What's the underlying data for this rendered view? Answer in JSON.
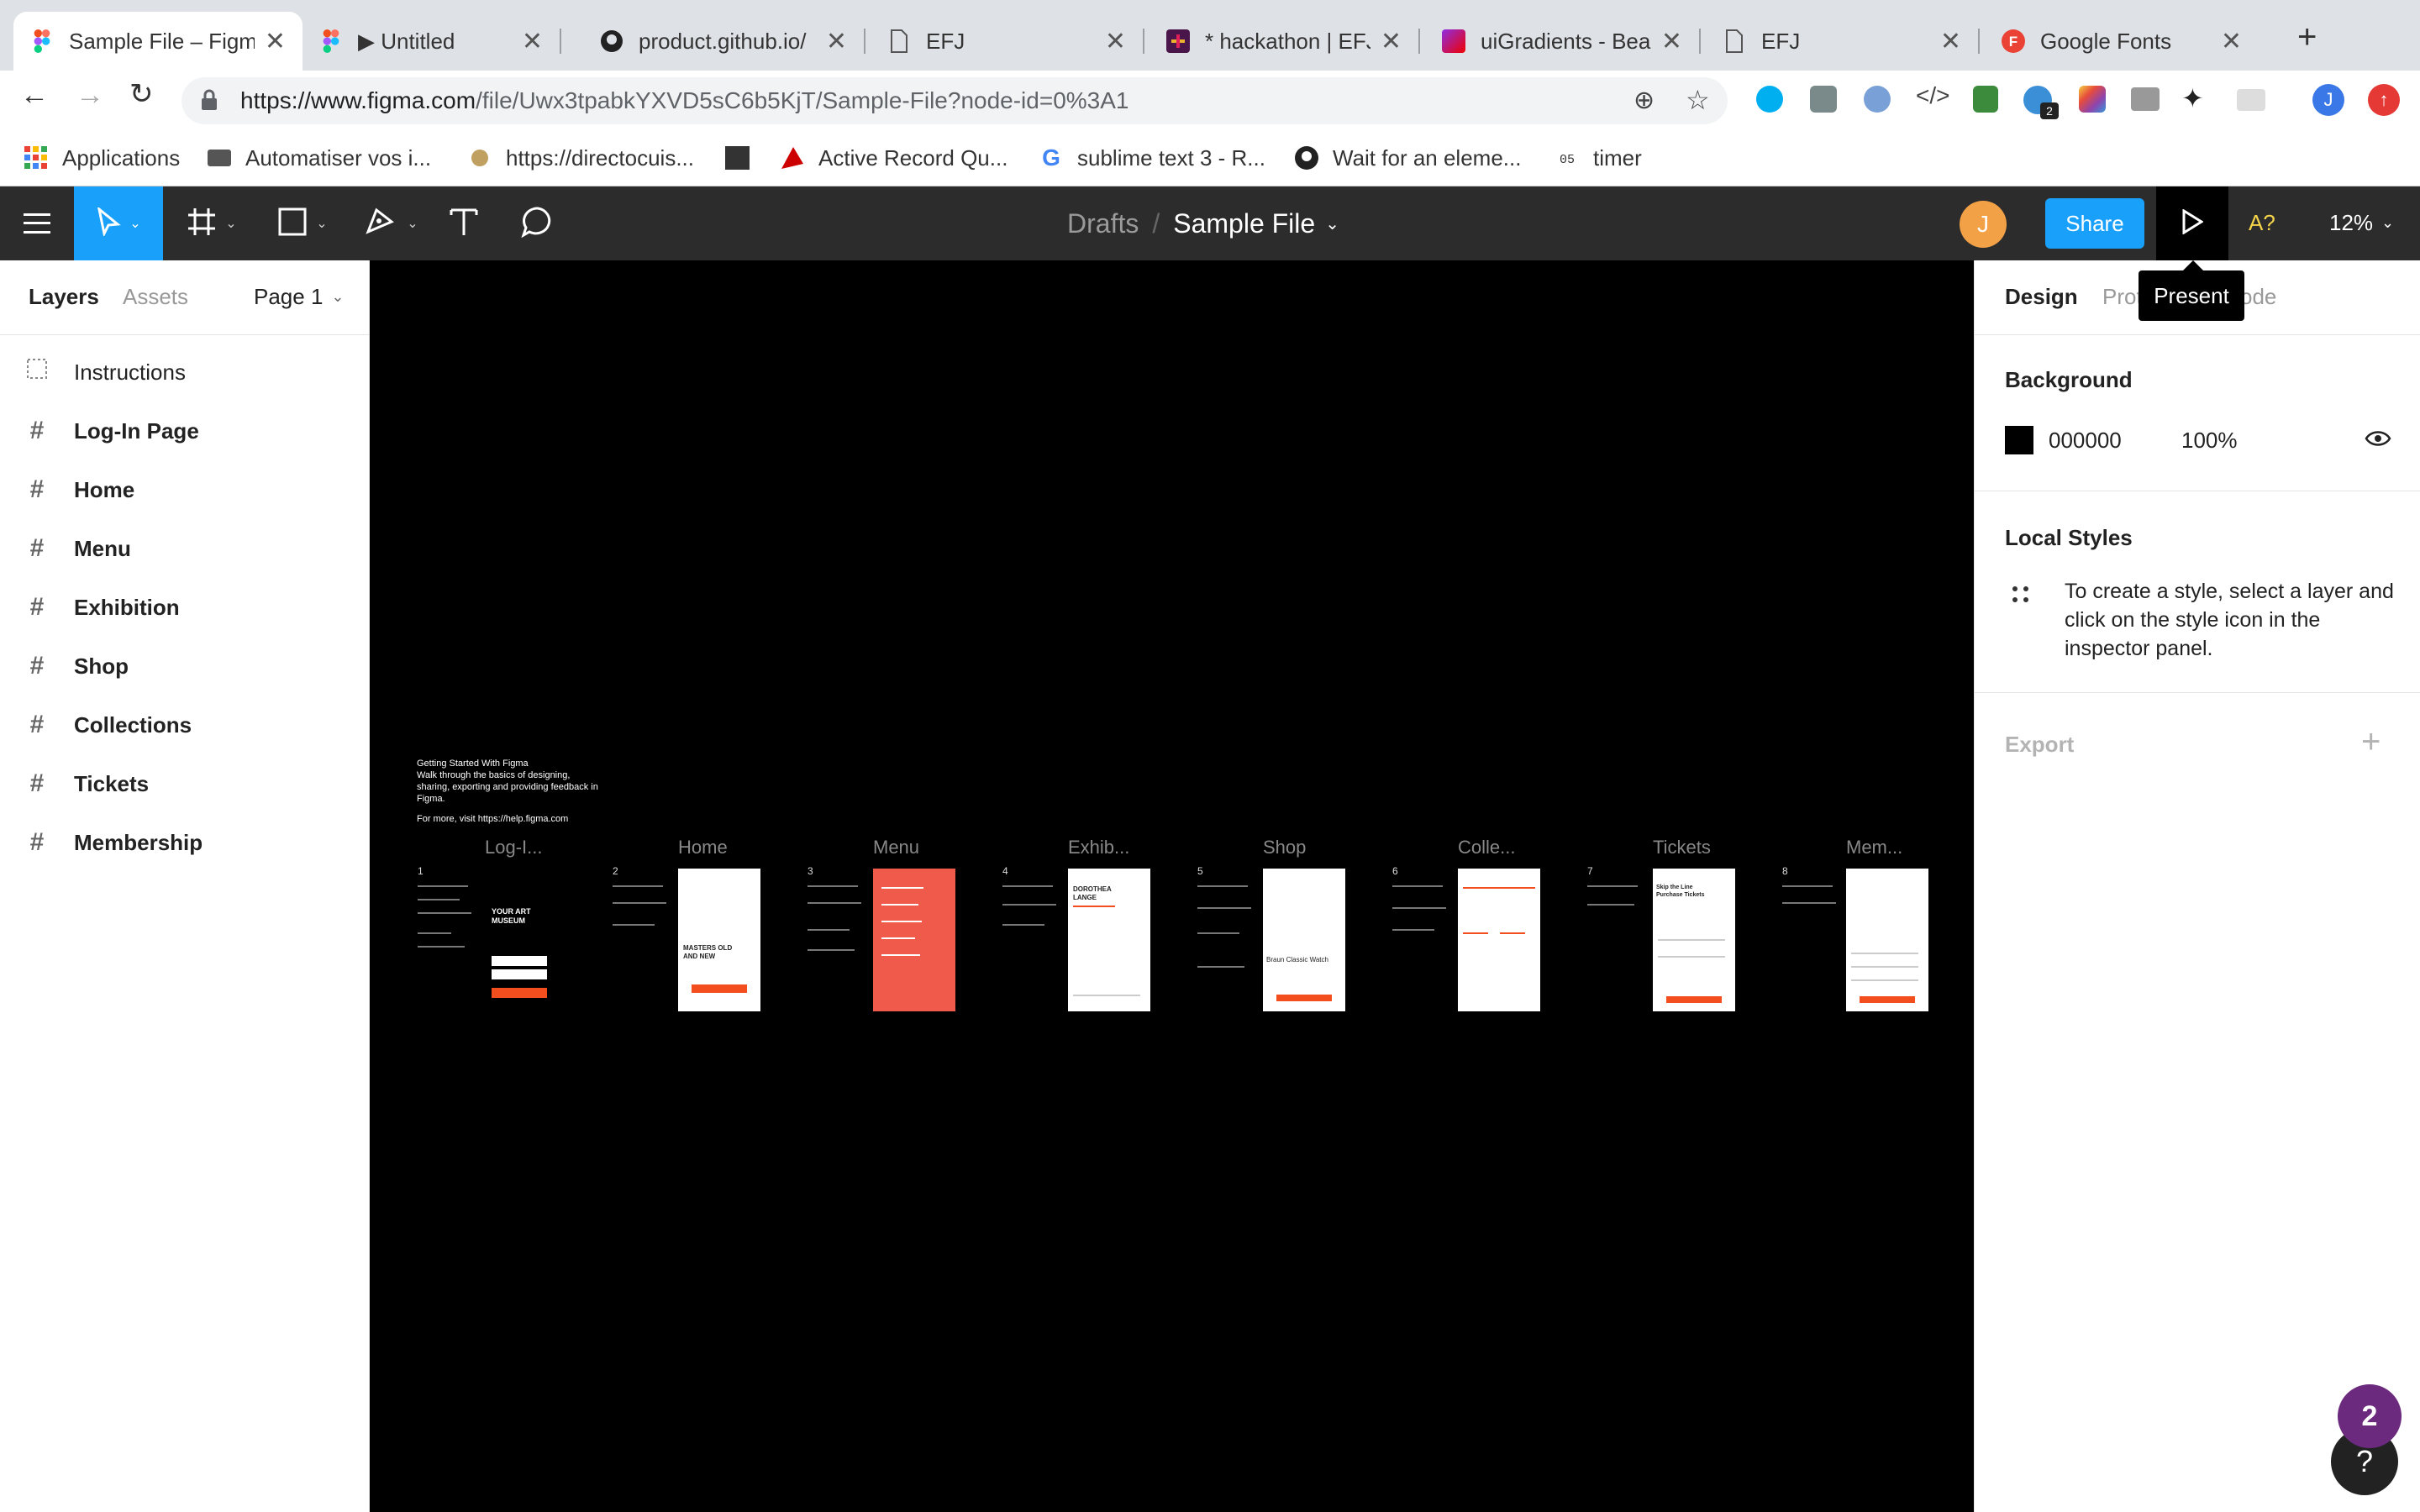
{
  "browser": {
    "tabs": [
      {
        "title": "Sample File – Figma",
        "active": true,
        "icon": "figma-icon"
      },
      {
        "title": "▶ Untitled",
        "icon": "figma-icon"
      },
      {
        "title": "product.github.io/",
        "icon": "github-icon"
      },
      {
        "title": "EFJ",
        "icon": "document-icon"
      },
      {
        "title": "* hackathon | EFJ",
        "icon": "slack-icon"
      },
      {
        "title": "uiGradients - Beau",
        "icon": "gradient-icon"
      },
      {
        "title": "EFJ",
        "icon": "document-icon"
      },
      {
        "title": "Google Fonts",
        "icon": "google-fonts-icon"
      }
    ],
    "url_host": "https://www.figma.com",
    "url_path": "/file/Uwx3tpabkYXVD5sC6b5KjT/Sample-File?node-id=0%3A1",
    "bookmarks": [
      {
        "label": "Applications",
        "icon": "apps-grid-icon"
      },
      {
        "label": "Automatiser vos i...",
        "icon": "bookmark-icon"
      },
      {
        "label": "https://directocuis...",
        "icon": "bookmark-icon"
      },
      {
        "label": "",
        "icon": "docker-icon"
      },
      {
        "label": "Active Record Qu...",
        "icon": "rails-icon"
      },
      {
        "label": "sublime text 3 - R...",
        "icon": "google-icon"
      },
      {
        "label": "Wait for an eleme...",
        "icon": "github-icon"
      },
      {
        "label": "timer",
        "icon": "timer-icon"
      }
    ],
    "profile_initial": "J"
  },
  "figma": {
    "breadcrumb_parent": "Drafts",
    "breadcrumb_sep": "/",
    "file_name": "Sample File",
    "avatar_initial": "J",
    "share_label": "Share",
    "present_tooltip": "Present",
    "a11y_label": "A?",
    "zoom": "12%",
    "left": {
      "tab_layers": "Layers",
      "tab_assets": "Assets",
      "page": "Page 1",
      "layers": [
        {
          "name": "Instructions",
          "type": "group"
        },
        {
          "name": "Log-In Page",
          "type": "frame"
        },
        {
          "name": "Home",
          "type": "frame"
        },
        {
          "name": "Menu",
          "type": "frame"
        },
        {
          "name": "Exhibition",
          "type": "frame"
        },
        {
          "name": "Shop",
          "type": "frame"
        },
        {
          "name": "Collections",
          "type": "frame"
        },
        {
          "name": "Tickets",
          "type": "frame"
        },
        {
          "name": "Membership",
          "type": "frame"
        }
      ]
    },
    "right": {
      "tab_design": "Design",
      "tab_prototype": "Prot",
      "tab_code": "ode",
      "background_title": "Background",
      "bg_hex": "000000",
      "bg_opacity": "100%",
      "bg_color": "#000000",
      "local_styles_title": "Local Styles",
      "local_styles_hint": "To create a style, select a layer and click on the style icon in the inspector panel.",
      "export_title": "Export",
      "export_add": "+"
    },
    "canvas": {
      "intro_title": "Getting Started With Figma",
      "intro_body": "Walk through the basics of designing, sharing, exporting and providing feedback in Figma.",
      "intro_link": "For more, visit https://help.figma.com",
      "frames": [
        {
          "num": "1",
          "label": "Log-I...",
          "headline": "YOUR ART MUSEUM"
        },
        {
          "num": "2",
          "label": "Home",
          "headline": "MASTERS OLD AND NEW"
        },
        {
          "num": "3",
          "label": "Menu",
          "headline": ""
        },
        {
          "num": "4",
          "label": "Exhib...",
          "headline": "DOROTHEA LANGE"
        },
        {
          "num": "5",
          "label": "Shop",
          "headline": "Braun Classic Watch"
        },
        {
          "num": "6",
          "label": "Colle...",
          "headline": ""
        },
        {
          "num": "7",
          "label": "Tickets",
          "headline": "Skip the Line Purchase Tickets"
        },
        {
          "num": "8",
          "label": "Mem...",
          "headline": ""
        }
      ]
    },
    "notification_count": "2",
    "help_label": "?",
    "accent": "#18a0fb",
    "brand_red": "#f24e1e"
  }
}
